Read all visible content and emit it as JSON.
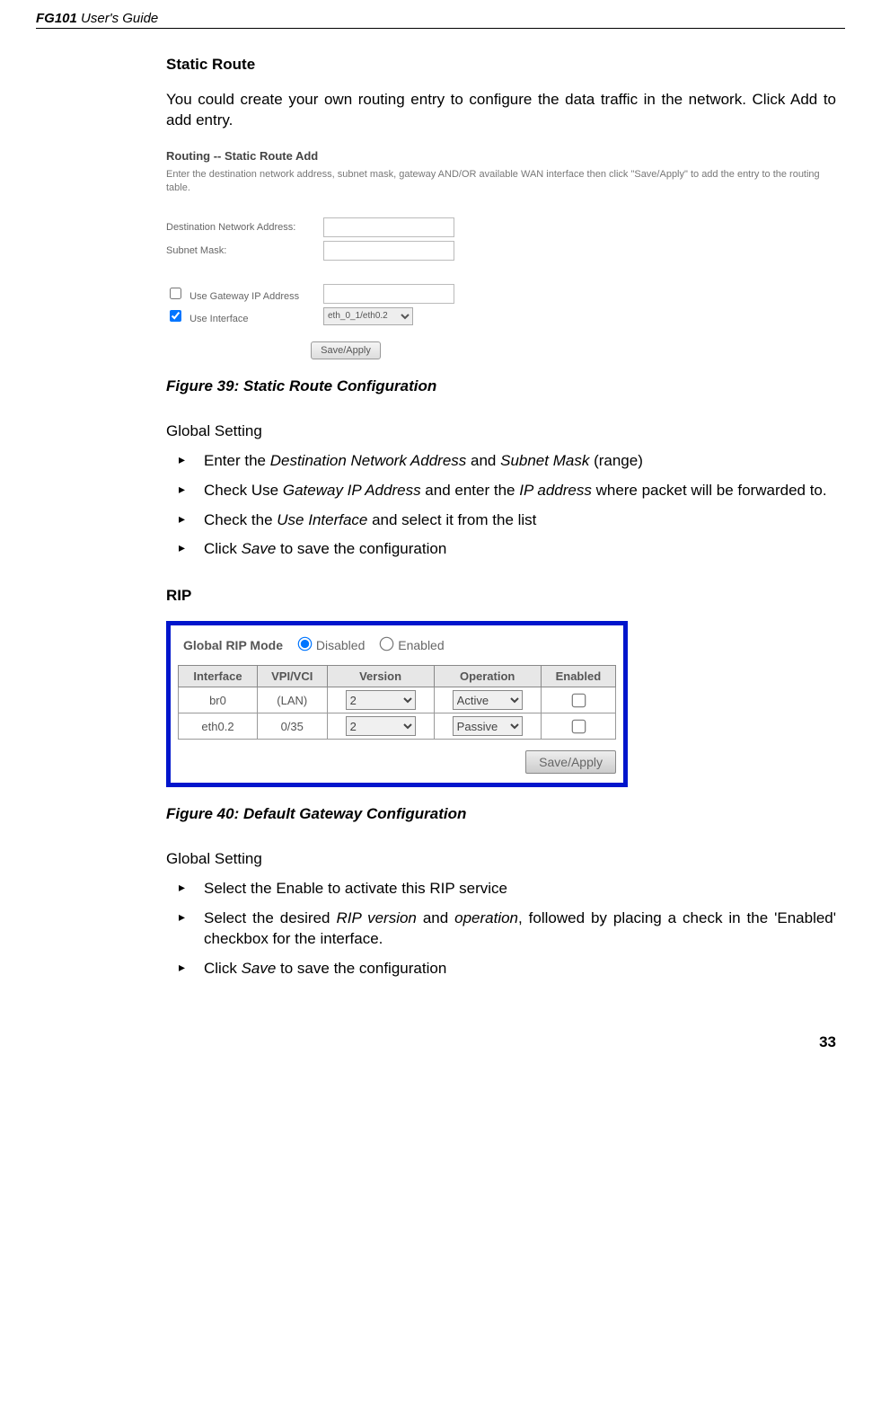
{
  "header": {
    "model": "FG101",
    "suffix": "User's Guide"
  },
  "section1": {
    "heading": "Static Route",
    "body": "You could create your own routing entry to configure the data traffic in the network. Click Add to add entry."
  },
  "shot1": {
    "title": "Routing -- Static Route Add",
    "desc": "Enter the destination network address, subnet mask, gateway AND/OR available WAN interface then click \"Save/Apply\" to add the entry to the routing table.",
    "dest_label": "Destination Network Address:",
    "mask_label": "Subnet Mask:",
    "gw_label": "Use Gateway IP Address",
    "if_label": "Use Interface",
    "if_value": "eth_0_1/eth0.2",
    "save_btn": "Save/Apply"
  },
  "fig39": "Figure 39: Static Route Configuration",
  "gs1": {
    "heading": "Global Setting",
    "b1a": "Enter the ",
    "b1b": "Destination Network Address",
    "b1c": " and ",
    "b1d": "Subnet Mask",
    "b1e": " (range)",
    "b2a": "Check Use ",
    "b2b": "Gateway IP Address",
    "b2c": " and enter the ",
    "b2d": "IP address",
    "b2e": " where packet will be forwarded to.",
    "b3a": "Check the ",
    "b3b": "Use Interface",
    "b3c": " and select it from the list",
    "b4a": "Click ",
    "b4b": "Save",
    "b4c": " to save the configuration"
  },
  "rip": {
    "heading": "RIP"
  },
  "shot2": {
    "mode_label": "Global RIP Mode",
    "disabled": "Disabled",
    "enabled": "Enabled",
    "headers": {
      "iface": "Interface",
      "vpivci": "VPI/VCI",
      "version": "Version",
      "operation": "Operation",
      "enabled": "Enabled"
    },
    "rows": [
      {
        "iface": "br0",
        "vpivci": "(LAN)",
        "version": "2",
        "operation": "Active"
      },
      {
        "iface": "eth0.2",
        "vpivci": "0/35",
        "version": "2",
        "operation": "Passive"
      }
    ],
    "save_btn": "Save/Apply"
  },
  "fig40": "Figure 40: Default Gateway Configuration",
  "gs2": {
    "heading": "Global Setting",
    "b1": "Select the Enable to activate this RIP service",
    "b2a": "Select the desired ",
    "b2b": "RIP version",
    "b2c": " and ",
    "b2d": "operation",
    "b2e": ", followed by placing a check in the 'Enabled' checkbox for the interface.",
    "b3a": "Click ",
    "b3b": "Save",
    "b3c": " to save the configuration"
  },
  "pagenum": "33"
}
